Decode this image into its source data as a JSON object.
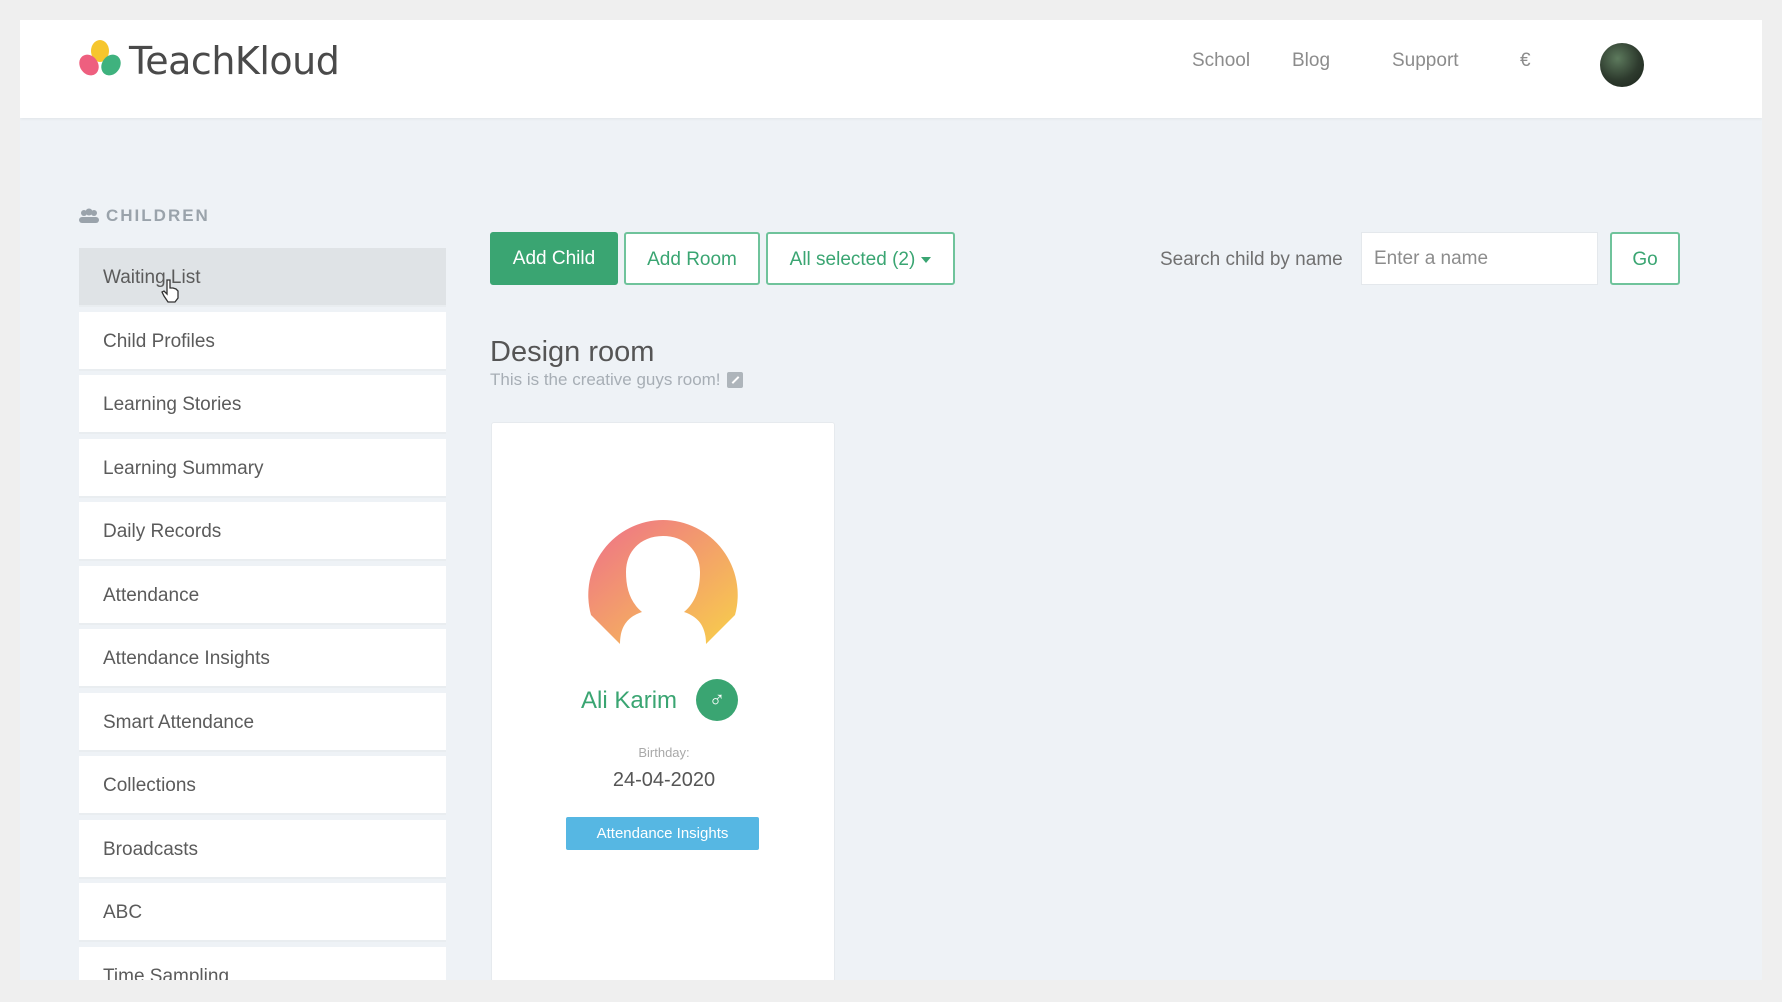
{
  "brand": {
    "name": "TeachKloud"
  },
  "nav": {
    "school": "School",
    "blog": "Blog",
    "support": "Support",
    "currency": "€"
  },
  "sidebar": {
    "section_label": "CHILDREN",
    "items": [
      {
        "label": "Waiting List"
      },
      {
        "label": "Child Profiles"
      },
      {
        "label": "Learning Stories"
      },
      {
        "label": "Learning Summary"
      },
      {
        "label": "Daily Records"
      },
      {
        "label": "Attendance"
      },
      {
        "label": "Attendance Insights"
      },
      {
        "label": "Smart Attendance"
      },
      {
        "label": "Collections"
      },
      {
        "label": "Broadcasts"
      },
      {
        "label": "ABC"
      },
      {
        "label": "Time Sampling"
      }
    ]
  },
  "toolbar": {
    "add_child": "Add Child",
    "add_room": "Add Room",
    "filter": "All selected (2)",
    "search_label": "Search child by name",
    "search_placeholder": "Enter a name",
    "go": "Go"
  },
  "room": {
    "title": "Design room",
    "description": "This is the creative guys room!"
  },
  "child_card": {
    "name": "Ali Karim",
    "gender_symbol": "♂",
    "birthday_label": "Birthday:",
    "birthday": "24-04-2020",
    "insights_button": "Attendance Insights"
  },
  "colors": {
    "accent_green": "#3aa572",
    "insights_blue": "#56b7e3",
    "page_bg": "#eef2f6"
  }
}
